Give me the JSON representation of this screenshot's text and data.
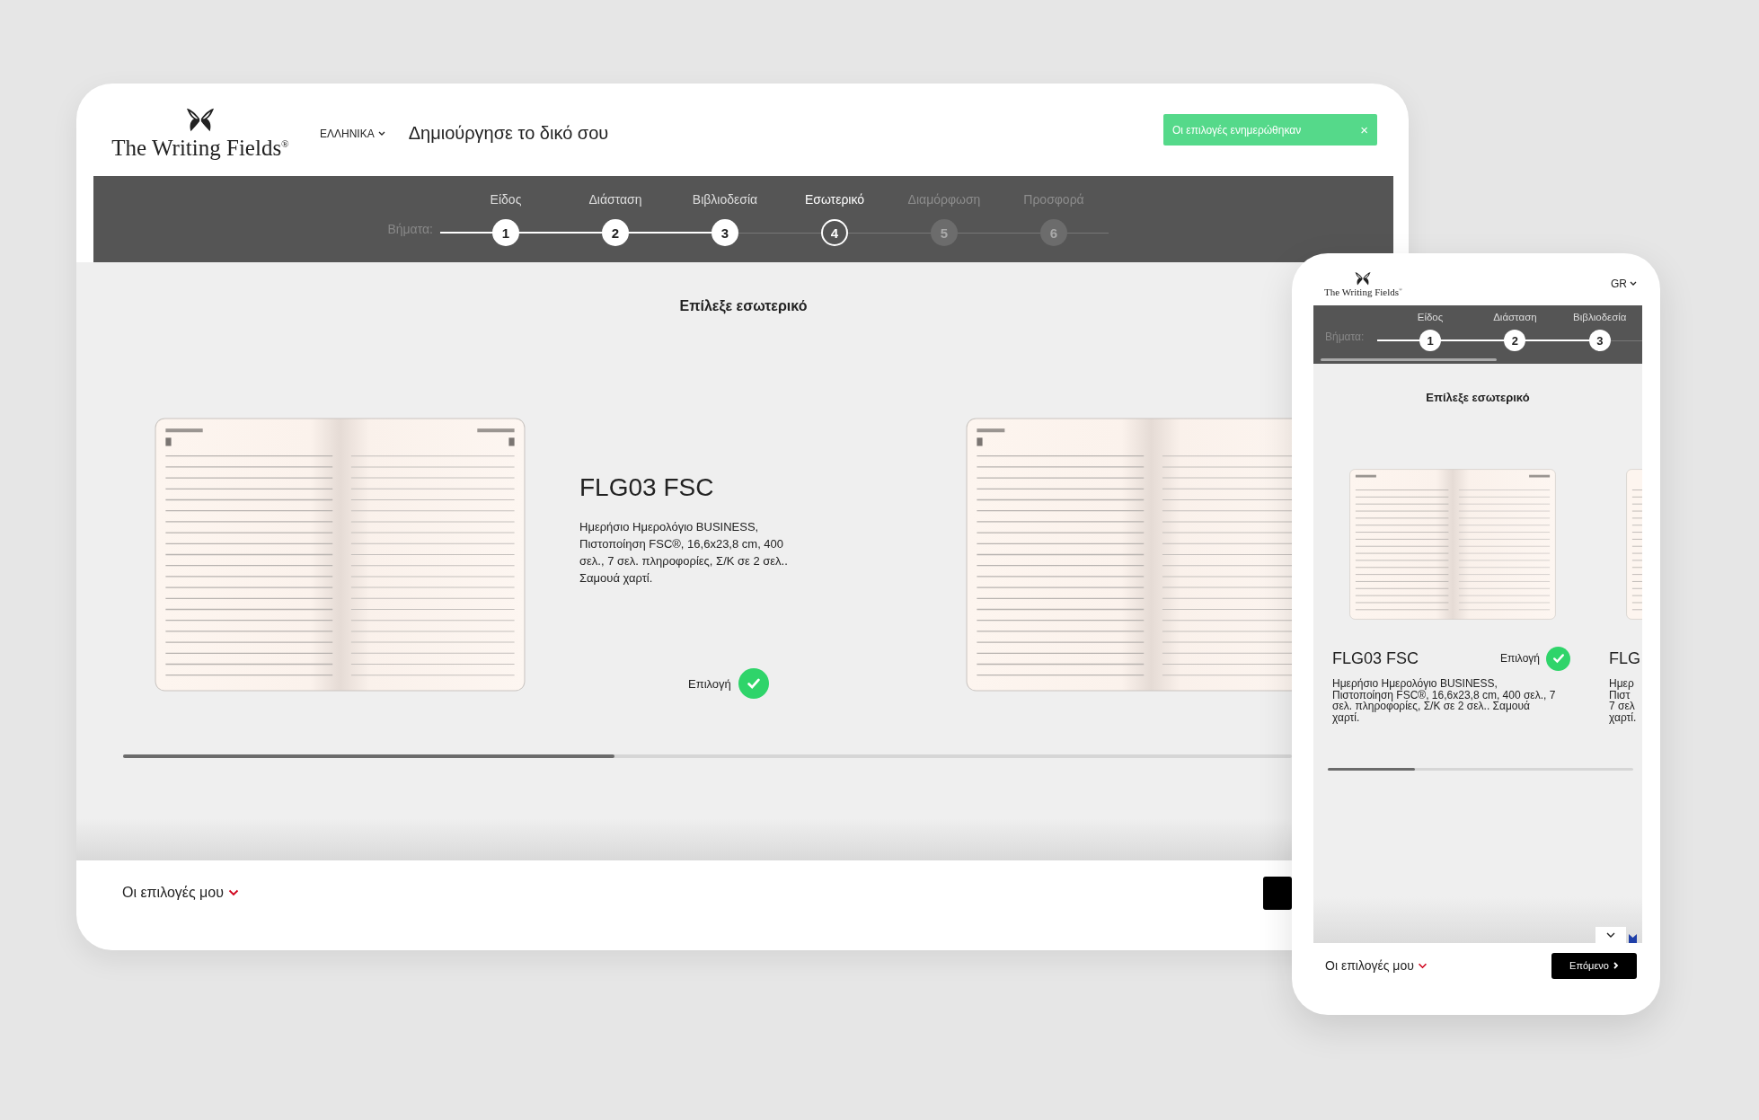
{
  "desktop": {
    "logo": "The Writing Fields$^{®}$",
    "language": "ΕΛΛΗΝΙΚΑ",
    "title": "Δημιούργησε το δικό σου",
    "toast": {
      "text": "Οι επιλογές ενημερώθηκαν",
      "close": "×"
    },
    "steps_label": "Βήματα:",
    "steps": [
      {
        "label": "Είδος",
        "number": "1",
        "done": true,
        "selected": false
      },
      {
        "label": "Διάσταση",
        "number": "2",
        "done": true,
        "selected": false
      },
      {
        "label": "Βιβλιοδεσία",
        "number": "3",
        "done": true,
        "selected": false
      },
      {
        "label": "Εσωτερικό",
        "number": "4",
        "done": false,
        "selected": true
      },
      {
        "label": "Διαμόρφωση",
        "number": "5",
        "done": false,
        "selected": false
      },
      {
        "label": "Προσφορά",
        "number": "6",
        "done": false,
        "selected": false
      }
    ],
    "heading": "Επίλεξε εσωτερικό",
    "products": [
      {
        "title": "FLG03 FSC",
        "description": "Ημερήσιο Ημερολόγιο BUSINESS, Πιστοποίηση FSC®, 16,6x23,8 cm, 400 σελ., 7 σελ. πληροφορίες, Σ/Κ σε 2 σελ.. Σαμουά χαρτί.",
        "choice_label": "Επιλογή",
        "selected": true
      }
    ],
    "footer": {
      "my_choices": "Οι επιλογές μου"
    }
  },
  "mobile": {
    "logo": "The Writing Fields$^{®}$",
    "language": "GR",
    "steps_label": "Βήματα:",
    "steps": [
      {
        "label": "Είδος",
        "number": "1",
        "done": true,
        "selected": false
      },
      {
        "label": "Διάσταση",
        "number": "2",
        "done": true,
        "selected": false
      },
      {
        "label": "Βιβλιοδεσία",
        "number": "3",
        "done": true,
        "selected": false
      }
    ],
    "heading": "Επίλεξε εσωτερικό",
    "products": [
      {
        "title": "FLG03 FSC",
        "description": "Ημερήσιο Ημερολόγιο BUSINESS, Πιστοποίηση FSC®, 16,6x23,8 cm, 400 σελ., 7 σελ. πληροφορίες, Σ/Κ σε 2 σελ.. Σαμουά χαρτί.",
        "choice_label": "Επιλογή",
        "selected": true
      }
    ],
    "next_product": {
      "title": "FLG",
      "lines": [
        "Ημερ",
        "Πιστ",
        "7 σελ",
        "χαρτί."
      ]
    },
    "footer": {
      "my_choices": "Οι επιλογές μου",
      "next": "Επόμενο"
    }
  }
}
